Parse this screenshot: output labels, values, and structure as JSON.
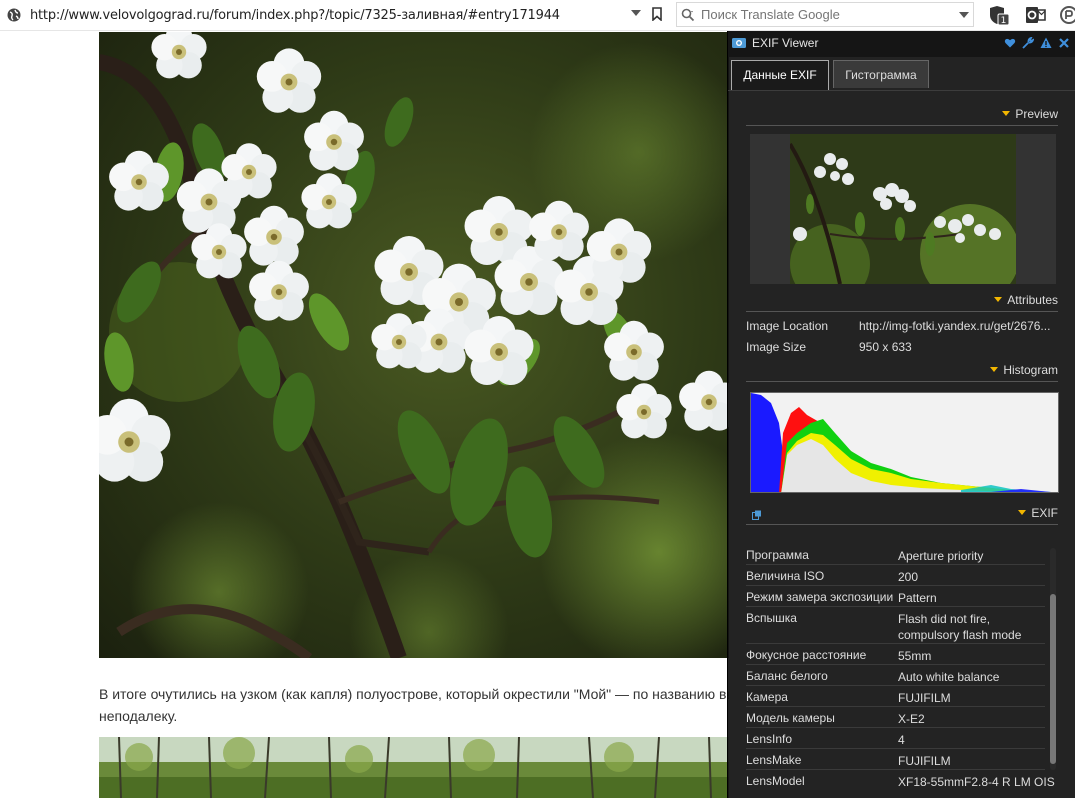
{
  "browser": {
    "url": "http://www.velovolgograd.ru/forum/index.php?/topic/7325-заливная/#entry171944",
    "search_placeholder": "Поиск Translate Google",
    "ext_badge": "1"
  },
  "article": {
    "paragraph_line1": "В итоге очутились на узком (как капля) полуострове, который окрестили \"Мой\" — по названию выделяющейся в",
    "paragraph_line2": "неподалеку."
  },
  "exif_panel": {
    "title": "EXIF Viewer",
    "tabs": [
      "Данные EXIF",
      "Гистограмма"
    ],
    "sections": {
      "preview": "Preview",
      "attributes": "Attributes",
      "histogram": "Histogram",
      "exif": "EXIF"
    },
    "attributes": [
      {
        "label": "Image Location",
        "value": "http://img-fotki.yandex.ru/get/2676..."
      },
      {
        "label": "Image Size",
        "value": "950 x 633"
      }
    ],
    "exif_rows": [
      {
        "key": "Программа",
        "value": "Aperture priority"
      },
      {
        "key": "Величина ISO",
        "value": "200"
      },
      {
        "key": "Режим замера экспозиции",
        "value": "Pattern"
      },
      {
        "key": "Вспышка",
        "value": "Flash did not fire, compulsory flash mode"
      },
      {
        "key": "Фокусное расстояние",
        "value": "55mm"
      },
      {
        "key": "Баланс белого",
        "value": "Auto white balance"
      },
      {
        "key": "Камера",
        "value": "FUJIFILM"
      },
      {
        "key": "Модель камеры",
        "value": "X-E2"
      },
      {
        "key": "LensInfo",
        "value": "4"
      },
      {
        "key": "LensMake",
        "value": "FUJIFILM"
      },
      {
        "key": "LensModel",
        "value": "XF18-55mmF2.8-4 R LM OIS"
      }
    ],
    "accent_color": "#f2b600"
  }
}
